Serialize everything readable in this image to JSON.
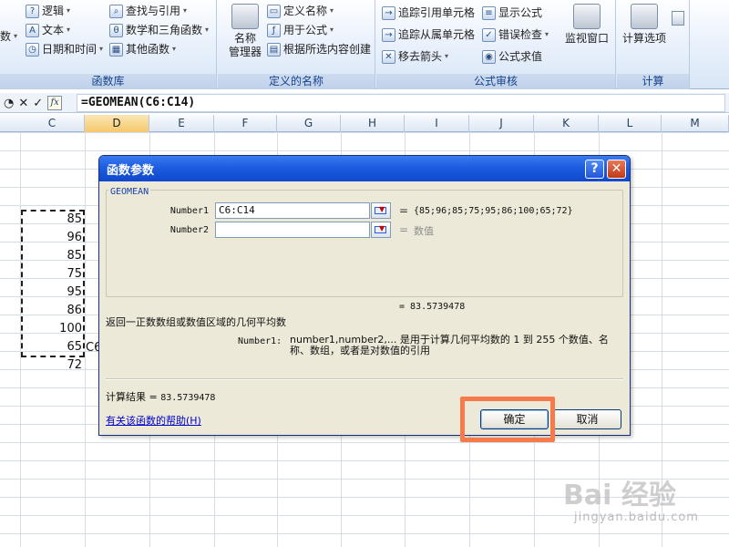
{
  "ribbon": {
    "groups": {
      "library": {
        "label": "函数库",
        "logical": "逻辑",
        "text": "文本",
        "datetime": "日期和时间",
        "partial_left": "数",
        "lookup": "查找与引用",
        "mathtrig": "数学和三角函数",
        "other": "其他函数"
      },
      "names": {
        "label": "定义的名称",
        "name_manager": "名称\n管理器",
        "name_manager_line1": "名称",
        "name_manager_line2": "管理器",
        "define_name": "定义名称",
        "use_in_formula": "用于公式",
        "create_from_selection": "根据所选内容创建"
      },
      "auditing": {
        "label": "公式审核",
        "trace_precedents": "追踪引用单元格",
        "trace_dependents": "追踪从属单元格",
        "remove_arrows": "移去箭头",
        "show_formulas": "显示公式",
        "error_checking": "错误检查",
        "evaluate_formula": "公式求值",
        "watch_window": "监视窗口"
      },
      "calculation": {
        "label": "计算",
        "calc_options": "计算选项"
      }
    }
  },
  "formula_bar": {
    "formula": "=GEOMEAN(C6:C14)"
  },
  "columns": [
    "C",
    "D",
    "E",
    "F",
    "G",
    "H",
    "I",
    "J",
    "K",
    "L",
    "M"
  ],
  "active_column": "D",
  "cells": {
    "c_values": [
      "85",
      "96",
      "85",
      "75",
      "95",
      "86",
      "100",
      "65",
      "72"
    ],
    "d_partial": "C6"
  },
  "dialog": {
    "title": "函数参数",
    "function_name": "GEOMEAN",
    "arg1_label": "Number1",
    "arg1_value": "C6:C14",
    "arg1_result": "{85;96;85;75;95;86;100;65;72}",
    "arg2_label": "Number2",
    "arg2_result": "数值",
    "formula_result_line": "= 83.5739478",
    "description": "返回一正数数组或数值区域的几何平均数",
    "arg_desc_label": "Number1:",
    "arg_desc_text": "number1,number2,... 是用于计算几何平均数的 1 到 255 个数值、名称、数组，或者是对数值的引用",
    "result_label": "计算结果 =",
    "result_value": "83.5739478",
    "help_link": "有关该函数的帮助(H)",
    "ok": "确定",
    "cancel": "取消"
  },
  "watermark": {
    "logo": "Bai 经验",
    "url": "jingyan.baidu.com"
  },
  "colors": {
    "titlebar": "#1d5ce0",
    "dialog_bg": "#ece9d8",
    "highlight": "#f67a4a",
    "ribbon_label": "#15428b"
  }
}
